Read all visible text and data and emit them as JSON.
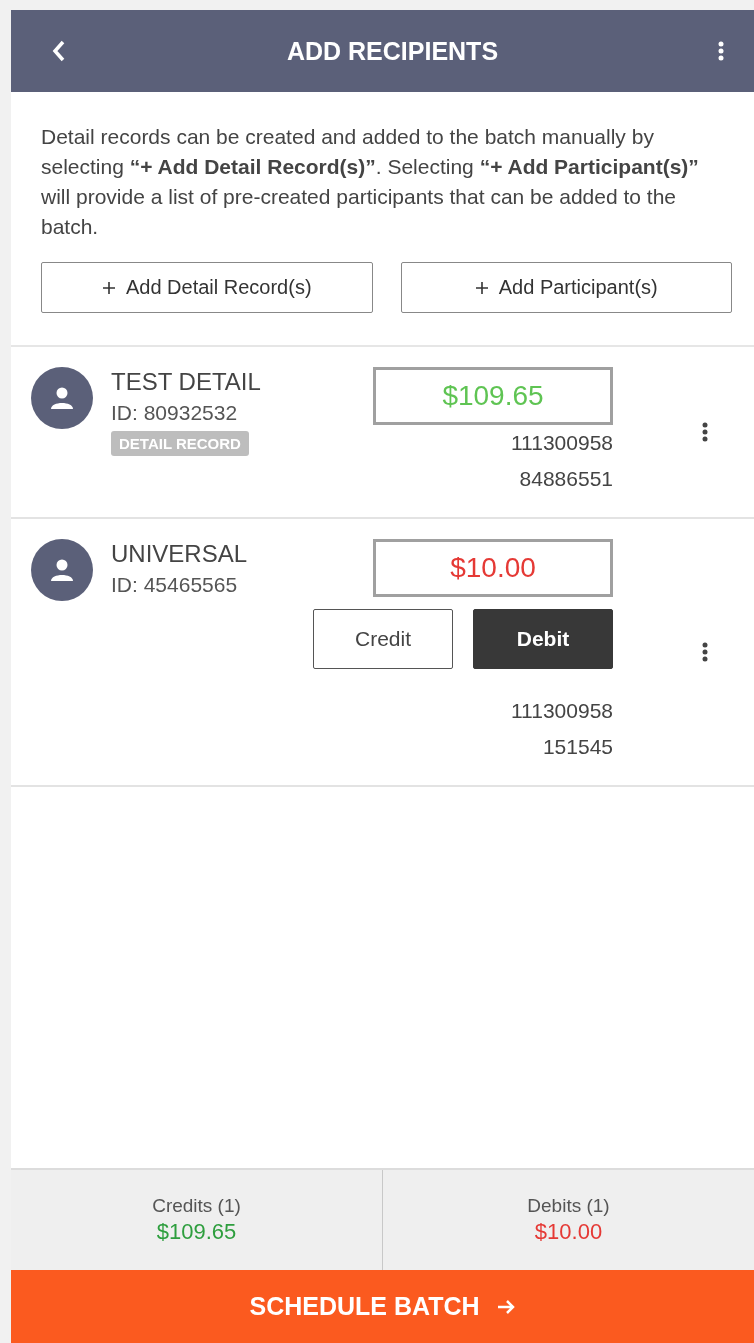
{
  "header": {
    "title": "ADD RECIPIENTS"
  },
  "intro": "Detail records can be created and added to the batch manually by selecting **“+ Add Detail Record(s)”**. Selecting **“+ Add Participant(s)”** will provide a list of pre-created participants that can be added to the batch.",
  "actions": [
    {
      "label": "Add Detail Record(s)"
    },
    {
      "label": "Add Participant(s)"
    }
  ],
  "recipients": [
    {
      "name": "TEST DETAIL",
      "id": "ID: 80932532",
      "tag": "DETAIL RECORD",
      "amount": "$109.65",
      "color": "#5fc453",
      "numbers": [
        "111300958",
        "84886551"
      ]
    },
    {
      "name": "UNIVERSAL",
      "id": "ID: 45465565",
      "amount": "$10.00",
      "color": "#e53935",
      "toggle": [
        {
          "label": "Credit",
          "selected": false
        },
        {
          "label": "Debit",
          "selected": true
        }
      ],
      "numbers": [
        "111300958",
        "151545"
      ]
    }
  ],
  "totals": [
    {
      "label": "Credits (1)",
      "amount": "$109.65",
      "color": "#2e9e3e"
    },
    {
      "label": "Debits (1)",
      "amount": "$10.00",
      "color": "#e53935"
    }
  ],
  "submit": {
    "label": "SCHEDULE BATCH"
  }
}
